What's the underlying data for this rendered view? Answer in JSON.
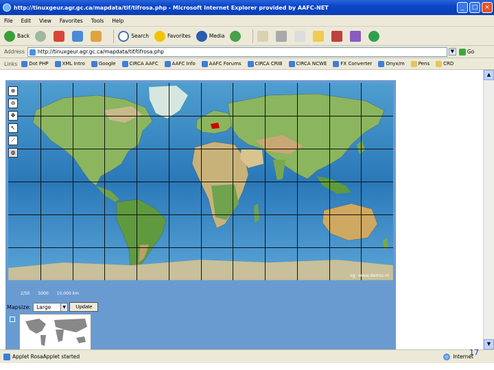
{
  "window": {
    "title": "http://tinuxgeur.agr.gc.ca/mapdata/tif/tifrosa.php - Microsoft Internet Explorer provided by AAFC-NET",
    "controls": [
      "_",
      "□",
      "×"
    ]
  },
  "menubar": {
    "items": [
      "File",
      "Edit",
      "View",
      "Favorites",
      "Tools",
      "Help"
    ]
  },
  "toolbar": {
    "back": "Back",
    "search": "Search",
    "favorites": "Favorites",
    "media": "Media"
  },
  "addressbar": {
    "label": "Address",
    "url": "http://tinuxgeur.agr.gc.ca/mapdata/tif/tifrosa.php",
    "go": "Go"
  },
  "linksbar": {
    "label": "Links",
    "items": [
      {
        "label": "Dot PHP",
        "icon": "page-icon"
      },
      {
        "label": "XML Intro",
        "icon": "page-icon"
      },
      {
        "label": "Google",
        "icon": "page-icon"
      },
      {
        "label": "CIRCA AAFC",
        "icon": "page-icon"
      },
      {
        "label": "AAFC Info",
        "icon": "page-icon"
      },
      {
        "label": "AAFC Forums",
        "icon": "page-icon"
      },
      {
        "label": "CIRCA CRIB",
        "icon": "page-icon"
      },
      {
        "label": "CIRCA NCWE",
        "icon": "page-icon"
      },
      {
        "label": "FX Converter",
        "icon": "page-icon"
      },
      {
        "label": "Onyx/m",
        "icon": "page-icon"
      },
      {
        "label": "Pens",
        "icon": "folder-icon"
      },
      {
        "label": "CRD",
        "icon": "folder-icon"
      }
    ]
  },
  "applet": {
    "map_credit": "sg: www.demis.nl",
    "scale_labels": [
      "2/50",
      "5000",
      "10,000 km"
    ],
    "mapsize_label": "Mapsize:",
    "mapsize_value": "Large",
    "update_label": "Update",
    "tools": [
      "zoom-in",
      "zoom-out",
      "pan",
      "identify",
      "measure",
      "globe"
    ]
  },
  "statusbar": {
    "text": "Applet RosaApplet started",
    "zone": "Internet"
  },
  "slide": {
    "page_number": "17"
  },
  "colors": {
    "titlebar": "#0a46c8",
    "chrome": "#ece9d8",
    "applet_bg": "#6a9bd0",
    "ocean": "#2e7fb8",
    "land": "#7fb25a",
    "highlight": "#cc0000"
  }
}
